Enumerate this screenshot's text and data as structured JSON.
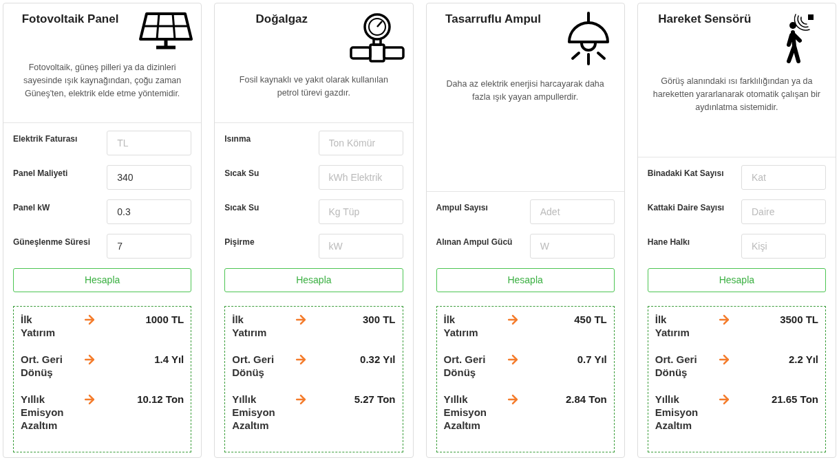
{
  "cards": [
    {
      "title": "Fotovoltaik Panel",
      "kind": "solar",
      "description": "Fotovoltaik, güneş pilleri ya da dizinleri sayesinde ışık kaynağından, çoğu zaman Güneş'ten, elektrik elde etme yöntemidir.",
      "fields": [
        {
          "label": "Elektrik Faturası",
          "placeholder": "TL"
        },
        {
          "label": "Panel Maliyeti",
          "value": "340"
        },
        {
          "label": "Panel kW",
          "value": "0.3"
        },
        {
          "label": "Güneşlenme Süresi",
          "value": "7"
        }
      ],
      "button": "Hesapla",
      "results": [
        {
          "label": "İlk Yatırım",
          "value": "1000 TL"
        },
        {
          "label": "Ort. Geri Dönüş",
          "value": "1.4 Yıl"
        },
        {
          "label": "Yıllık Emisyon Azaltım",
          "value": "10.12 Ton"
        }
      ]
    },
    {
      "title": "Doğalgaz",
      "kind": "gauge",
      "description": "Fosil kaynaklı ve yakıt olarak kullanılan petrol türevi gazdır.",
      "fields": [
        {
          "label": "Isınma",
          "placeholder": "Ton Kömür"
        },
        {
          "label": "Sıcak Su",
          "placeholder": "kWh Elektrik"
        },
        {
          "label": "Sıcak Su",
          "placeholder": "Kg Tüp"
        },
        {
          "label": "Pişirme",
          "placeholder": "kW"
        }
      ],
      "button": "Hesapla",
      "results": [
        {
          "label": "İlk Yatırım",
          "value": "300 TL"
        },
        {
          "label": "Ort. Geri Dönüş",
          "value": "0.32 Yıl"
        },
        {
          "label": "Yıllık Emisyon Azaltım",
          "value": "5.27 Ton"
        }
      ]
    },
    {
      "title": "Tasarruflu Ampul",
      "kind": "lamp",
      "description": "Daha az elektrik enerjisi harcayarak daha fazla ışık yayan ampullerdir.",
      "fields": [
        {
          "label": "Ampul Sayısı",
          "placeholder": "Adet"
        },
        {
          "label": "Alınan Ampul Gücü",
          "placeholder": "W"
        }
      ],
      "button": "Hesapla",
      "results": [
        {
          "label": "İlk Yatırım",
          "value": "450 TL"
        },
        {
          "label": "Ort. Geri Dönüş",
          "value": "0.7 Yıl"
        },
        {
          "label": "Yıllık Emisyon Azaltım",
          "value": "2.84 Ton"
        }
      ]
    },
    {
      "title": "Hareket Sensörü",
      "kind": "walker",
      "description": "Görüş alanındaki ısı farklılığından ya da hareketten yararlanarak otomatik çalışan bir aydınlatma sistemidir.",
      "fields": [
        {
          "label": "Binadaki Kat Sayısı",
          "placeholder": "Kat"
        },
        {
          "label": "Kattaki Daire Sayısı",
          "placeholder": "Daire"
        },
        {
          "label": "Hane Halkı",
          "placeholder": "Kişi"
        }
      ],
      "button": "Hesapla",
      "results": [
        {
          "label": "İlk Yatırım",
          "value": "3500 TL"
        },
        {
          "label": "Ort. Geri Dönüş",
          "value": "2.2 Yıl"
        },
        {
          "label": "Yıllık Emisyon Azaltım",
          "value": "21.65 Ton"
        }
      ]
    }
  ]
}
